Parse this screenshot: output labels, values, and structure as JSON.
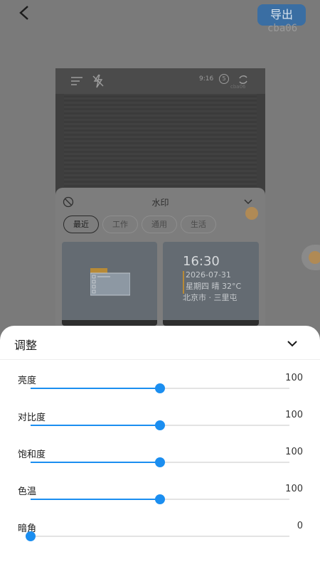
{
  "header": {
    "export_label": "导出",
    "watermark_id": "cba06"
  },
  "preview": {
    "time": "9:16",
    "timer_badge": "5",
    "overlay_id": "cba06"
  },
  "watermark": {
    "title": "水印",
    "tabs": [
      {
        "label": "最近",
        "active": true
      },
      {
        "label": "工作",
        "active": false
      },
      {
        "label": "通用",
        "active": false
      },
      {
        "label": "生活",
        "active": false
      }
    ],
    "card2": {
      "time": "16:30",
      "date": "2026-07-31",
      "weather": "星期四 晴 32°C",
      "place": "北京市 · 三里屯"
    }
  },
  "adjust": {
    "title": "调整",
    "sliders": [
      {
        "label": "亮度",
        "value": "100",
        "level": 0.5
      },
      {
        "label": "对比度",
        "value": "100",
        "level": 0.5
      },
      {
        "label": "饱和度",
        "value": "100",
        "level": 0.5
      },
      {
        "label": "色温",
        "value": "100",
        "level": 0.5
      },
      {
        "label": "暗角",
        "value": "0",
        "level": 0.0
      }
    ]
  },
  "colors": {
    "accent": "#1b8ef0",
    "export_button": "#3a6ea3"
  },
  "icons": [
    "back-icon",
    "menu-icon",
    "flash-off-icon",
    "timer-icon",
    "switch-camera-icon",
    "no-watermark-icon",
    "chevron-down-icon"
  ]
}
